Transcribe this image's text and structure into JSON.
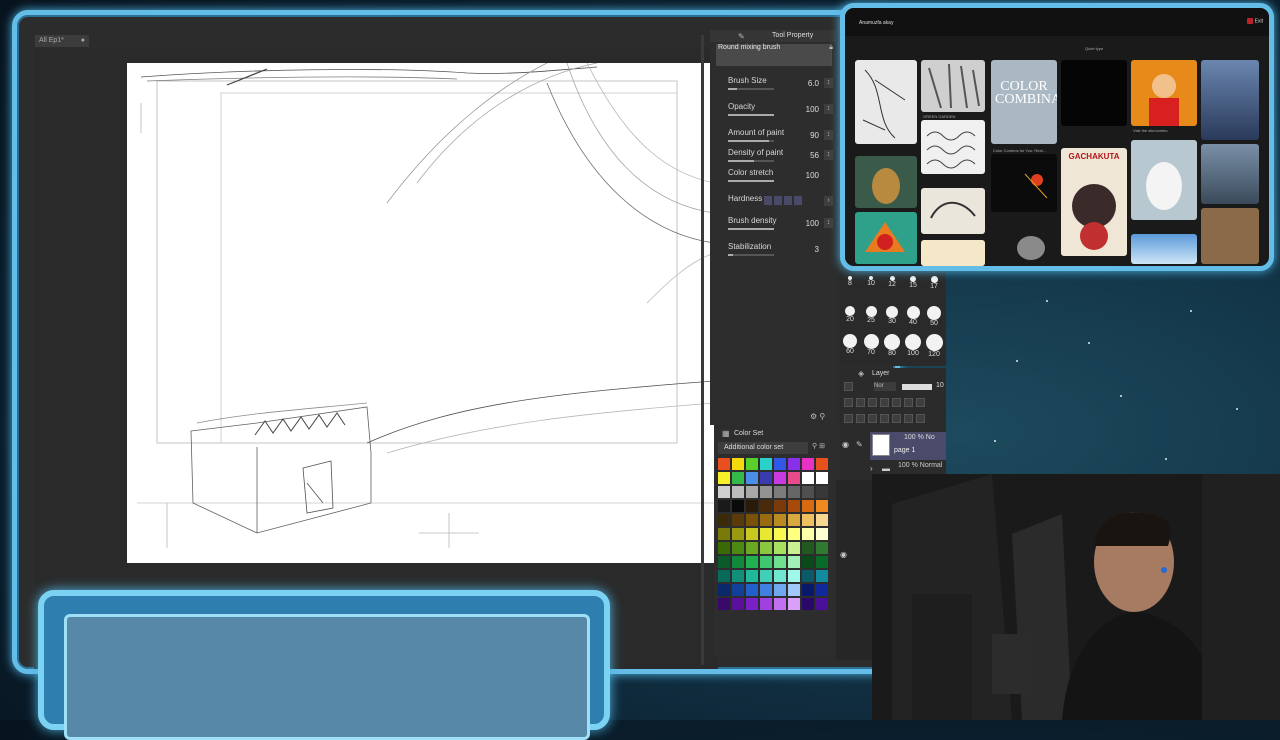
{
  "document_tab": {
    "title": "All Ep1*",
    "close": "●"
  },
  "tool_property": {
    "header": "Tool Property",
    "brush_name": "Round mixing brush",
    "properties": [
      {
        "label": "Brush Size",
        "value": "6.0",
        "fill": 0.2
      },
      {
        "label": "Opacity",
        "value": "100",
        "fill": 1.0
      },
      {
        "label": "Amount of paint",
        "value": "90",
        "fill": 0.9
      },
      {
        "label": "Density of paint",
        "value": "56",
        "fill": 0.56
      },
      {
        "label": "Color stretch",
        "value": "100",
        "fill": 1.0
      },
      {
        "label": "Hardness",
        "value": "",
        "fill": 0
      },
      {
        "label": "Brush density",
        "value": "100",
        "fill": 1.0
      },
      {
        "label": "Stabilization",
        "value": "3",
        "fill": 0.1
      }
    ]
  },
  "color_set": {
    "title": "Color Set",
    "selected_set": "Additional color set",
    "colors": [
      "#e8511f",
      "#f5d90f",
      "#57d12a",
      "#2ad1c9",
      "#2f57e8",
      "#8a2fe8",
      "#e82fc6",
      "#e8511f",
      "#f7ef2a",
      "#35b84a",
      "#4a8ee8",
      "#3b3bb0",
      "#c83be0",
      "#e84a8c",
      "#ffffff",
      "#ffffff",
      "#cfcfcf",
      "#bcbcbc",
      "#a8a8a8",
      "#939393",
      "#7c7c7c",
      "#666666",
      "#4f4f4f",
      "#383838",
      "#1a1a1a",
      "#0a0a0a",
      "#2a1a0a",
      "#4a2a0a",
      "#7a3a0a",
      "#a84a0a",
      "#d86a10",
      "#f08a20",
      "#3a2a08",
      "#5a3a08",
      "#7a5008",
      "#9a6a10",
      "#ba8a20",
      "#d8a840",
      "#eec060",
      "#f8d890",
      "#7a7a08",
      "#9a9a10",
      "#c8c820",
      "#e8e830",
      "#f8f850",
      "#ffff80",
      "#ffffa8",
      "#ffffd0",
      "#3a6a08",
      "#4a8a10",
      "#6aa820",
      "#8ac840",
      "#a8e060",
      "#c8f090",
      "#205a20",
      "#307a30",
      "#0a5a2a",
      "#108a3a",
      "#20b050",
      "#40c870",
      "#70e090",
      "#a0f0b8",
      "#0a4a1a",
      "#0a6a2a",
      "#086a5a",
      "#10907a",
      "#20b89a",
      "#40d0b8",
      "#70e8d0",
      "#a0f8e8",
      "#0a5a6a",
      "#108aa0",
      "#082a6a",
      "#10409a",
      "#2060c8",
      "#4080e0",
      "#70a8f0",
      "#a0c8f8",
      "#08186a",
      "#10289a",
      "#3a0a6a",
      "#5a109a",
      "#7a20c8",
      "#a040e0",
      "#c070f0",
      "#d8a0f8",
      "#2a086a",
      "#4a109a"
    ]
  },
  "brush_sizes": {
    "top_row": [
      "8",
      "10",
      "12",
      "15",
      "17"
    ],
    "rows": [
      [
        "20",
        "25",
        "30",
        "40",
        "50"
      ],
      [
        "60",
        "70",
        "80",
        "100",
        "120"
      ]
    ]
  },
  "layer_panel": {
    "title": "Layer",
    "blend_mode": "Nor",
    "opacity_value": "10",
    "layer_opacity": "100 % No",
    "layer_name": "page 1",
    "sublayer": "100 % Normal"
  },
  "browser": {
    "title": "Anamuzfa akay",
    "exit": "Exit",
    "subtitle": "Quiet type",
    "captions": [
      "GREEN GARDEN",
      "Color Combos for You: Real...",
      "Visit the site/combo"
    ],
    "tile_color_combo": "COLOR COMBINATIONS",
    "tile_gacha": "GACHAKUTA"
  }
}
